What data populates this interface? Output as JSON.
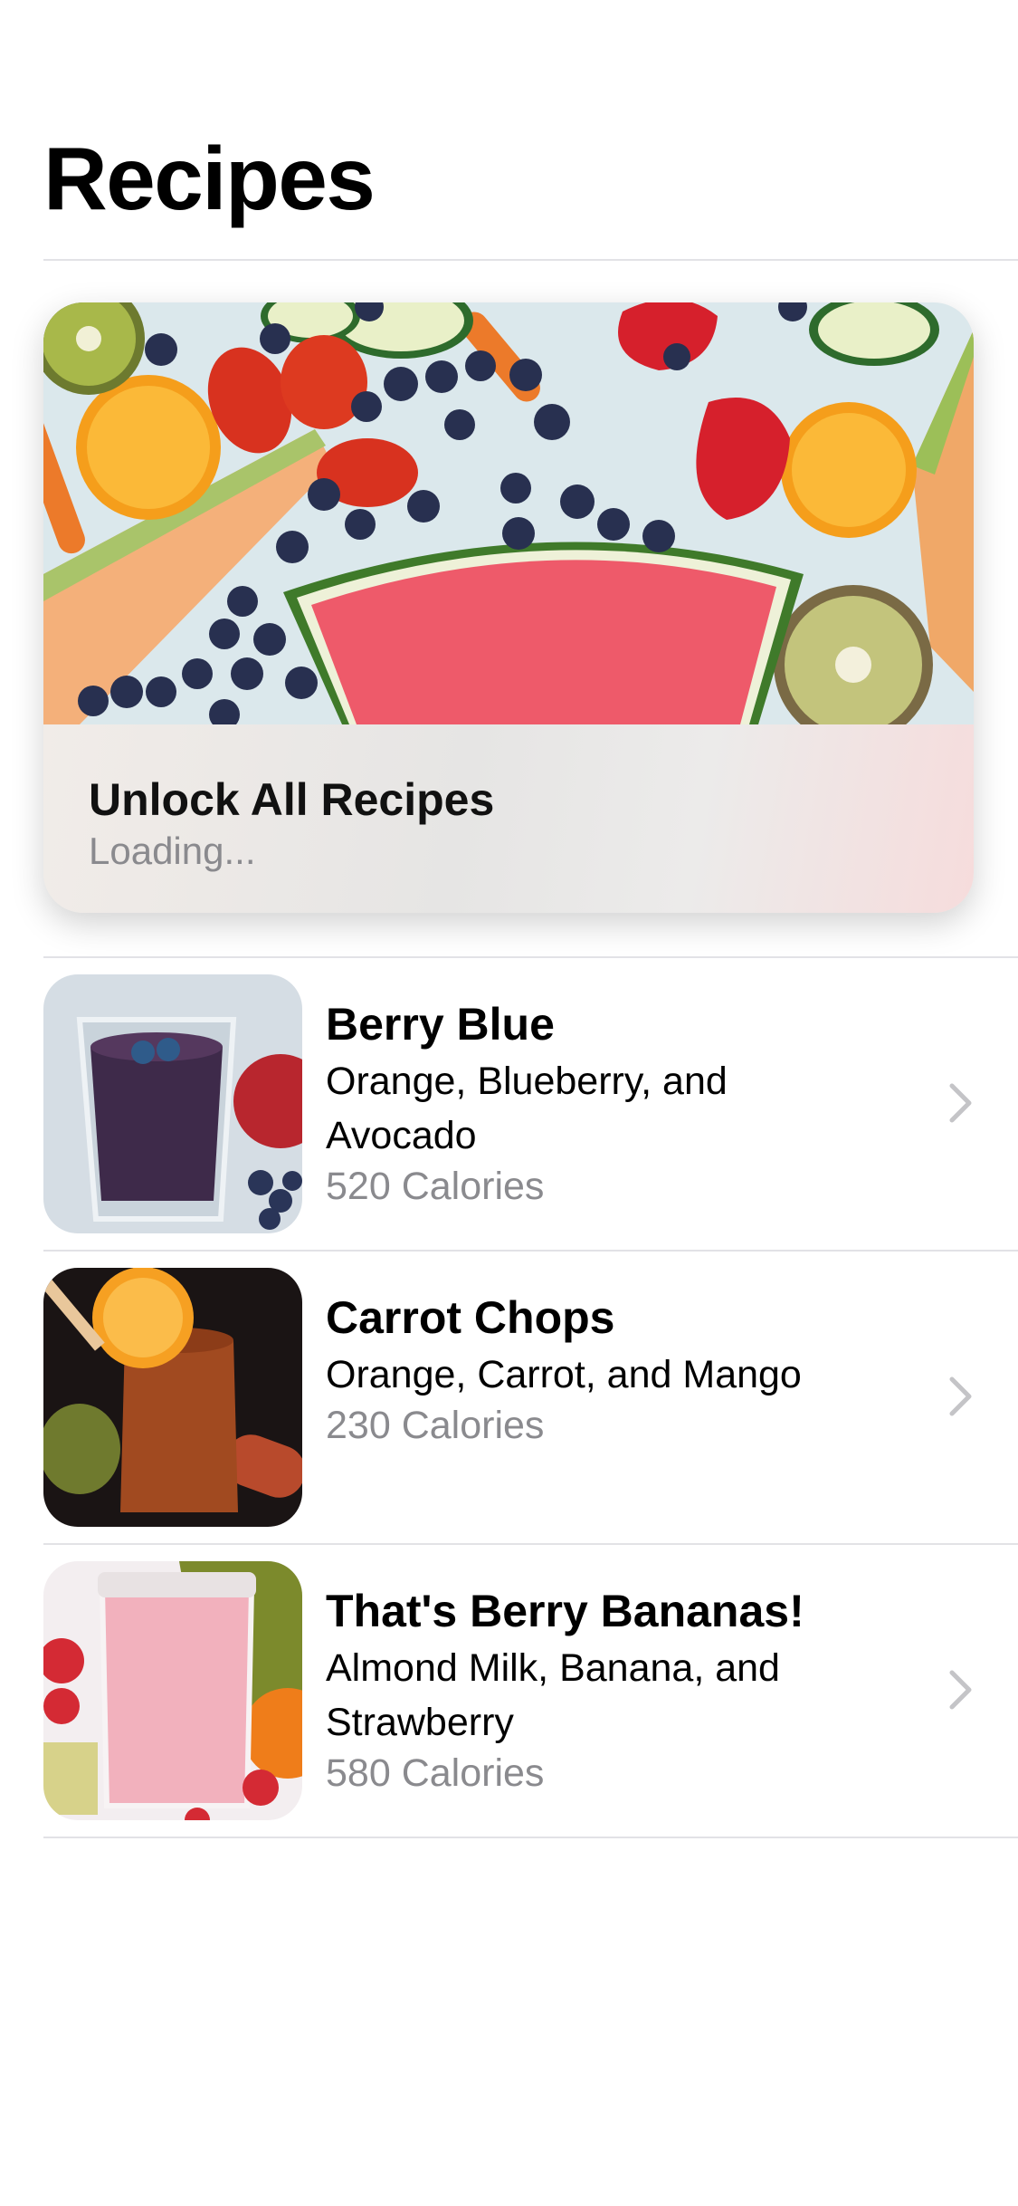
{
  "navigation": {
    "title": "Recipes"
  },
  "unlock_card": {
    "title": "Unlock All Recipes",
    "status": "Loading..."
  },
  "recipes": [
    {
      "name": "Berry Blue",
      "ingredients": "Orange, Blueberry, and Avocado",
      "calories": "520 Calories"
    },
    {
      "name": "Carrot Chops",
      "ingredients": "Orange, Carrot, and Mango",
      "calories": "230 Calories"
    },
    {
      "name": "That's Berry Bananas!",
      "ingredients": "Almond Milk, Banana, and Strawberry",
      "calories": "580 Calories"
    }
  ],
  "icons": {
    "row_disclosure": "chevron-right-icon"
  },
  "colors": {
    "secondary_text": "#8a8a8e",
    "separator": "#e2e2e6"
  }
}
